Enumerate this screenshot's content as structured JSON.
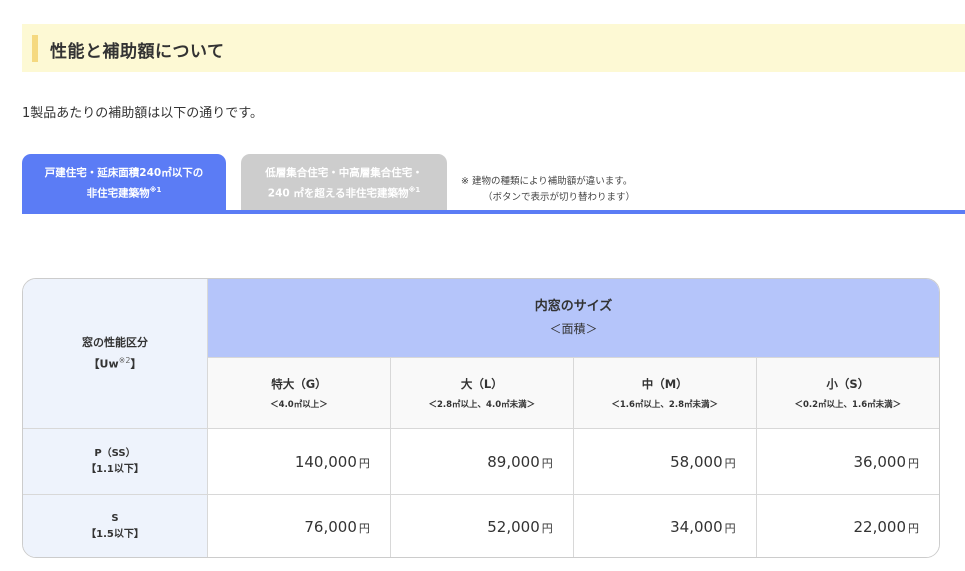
{
  "section": {
    "title": "性能と補助額について",
    "intro": "1製品あたりの補助額は以下の通りです。"
  },
  "tabs": [
    {
      "line1": "戸建住宅・延床面積240㎡以下の",
      "line2": "非住宅建築物",
      "note_mark": "※1",
      "active": true
    },
    {
      "line1": "低層集合住宅・中高層集合住宅・",
      "line2": "240 ㎡を超える非住宅建築物",
      "note_mark": "※1",
      "active": false
    }
  ],
  "tab_note": {
    "line1": "※ 建物の種類により補助額が違います。",
    "line2": "（ボタンで表示が切り替わります）"
  },
  "table": {
    "perf_header": {
      "line1": "窓の性能区分",
      "line2": "【Uw",
      "note_mark": "※2",
      "line2_end": "】"
    },
    "size_header": {
      "title": "内窓のサイズ",
      "subtitle": "＜面積＞"
    },
    "columns": [
      {
        "label": "特大（G）",
        "range": "＜4.0㎡以上＞"
      },
      {
        "label": "大（L）",
        "range": "＜2.8㎡以上、4.0㎡未満＞"
      },
      {
        "label": "中（M）",
        "range": "＜1.6㎡以上、2.8㎡未満＞"
      },
      {
        "label": "小（S）",
        "range": "＜0.2㎡以上、1.6㎡未満＞"
      }
    ],
    "rows": [
      {
        "grade": "P（SS）",
        "threshold": "【1.1以下】",
        "amounts": [
          "140,000",
          "89,000",
          "58,000",
          "36,000"
        ]
      },
      {
        "grade": "S",
        "threshold": "【1.5以下】",
        "amounts": [
          "76,000",
          "52,000",
          "34,000",
          "22,000"
        ]
      }
    ],
    "unit": "円"
  },
  "colors": {
    "heading_band": "#fdf9d4",
    "heading_accent": "#f5d980",
    "tab_active": "#5b7cf5",
    "tab_inactive": "#cdcdcd",
    "size_header_bg": "#b5c5fa",
    "row_header_bg": "#eef3fc"
  }
}
